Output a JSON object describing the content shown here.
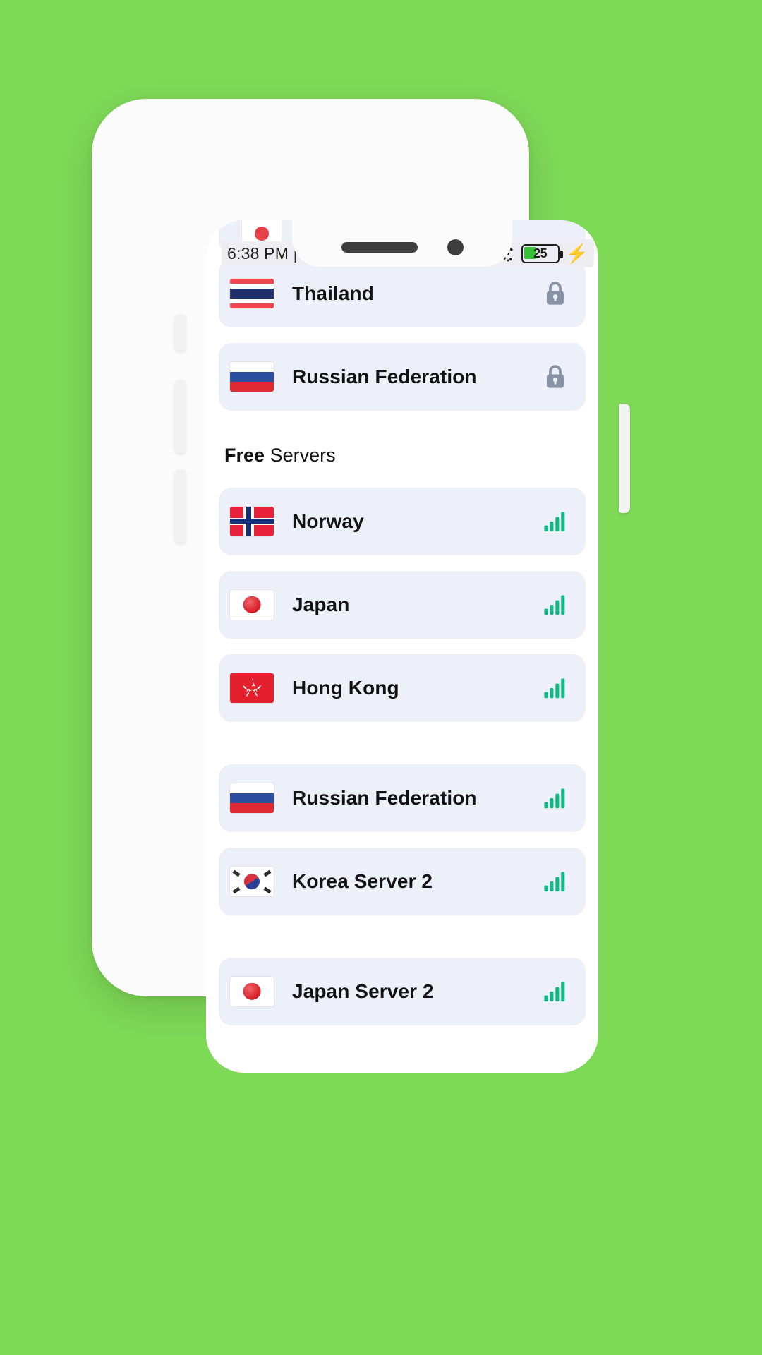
{
  "status_bar": {
    "time": "6:38 PM | 0",
    "wifi_icon": "wifi-icon",
    "battery_percent": "25",
    "charging_icon": "charging-bolt-icon"
  },
  "screen": {
    "section_header": {
      "bold_word": "Free",
      "rest_word": "Servers"
    },
    "premium_rows": [
      {
        "label": "Thailand",
        "flag": "th",
        "trailing_icon": "lock-icon"
      },
      {
        "label": "Russian Federation",
        "flag": "ru",
        "trailing_icon": "lock-icon"
      }
    ],
    "free_rows": [
      {
        "label": "Norway",
        "flag": "no",
        "trailing_icon": "signal-bars-icon",
        "signal_level": 4
      },
      {
        "label": "Japan",
        "flag": "jp",
        "trailing_icon": "signal-bars-icon",
        "signal_level": 4
      },
      {
        "label": "Hong Kong",
        "flag": "hk",
        "trailing_icon": "signal-bars-icon",
        "signal_level": 4
      },
      {
        "label": "Russian Federation",
        "flag": "ru",
        "trailing_icon": "signal-bars-icon",
        "signal_level": 4
      },
      {
        "label": "Korea Server 2",
        "flag": "kr",
        "trailing_icon": "signal-bars-icon",
        "signal_level": 4
      },
      {
        "label": "Japan Server 2",
        "flag": "jp",
        "trailing_icon": "signal-bars-icon",
        "signal_level": 4
      }
    ]
  },
  "colors": {
    "page_background": "#7ed957",
    "row_background": "#edf0f9",
    "signal_green": "#10b981",
    "lock_gray": "#8892a6",
    "text": "#121212",
    "battery_green": "#3ac13a"
  }
}
